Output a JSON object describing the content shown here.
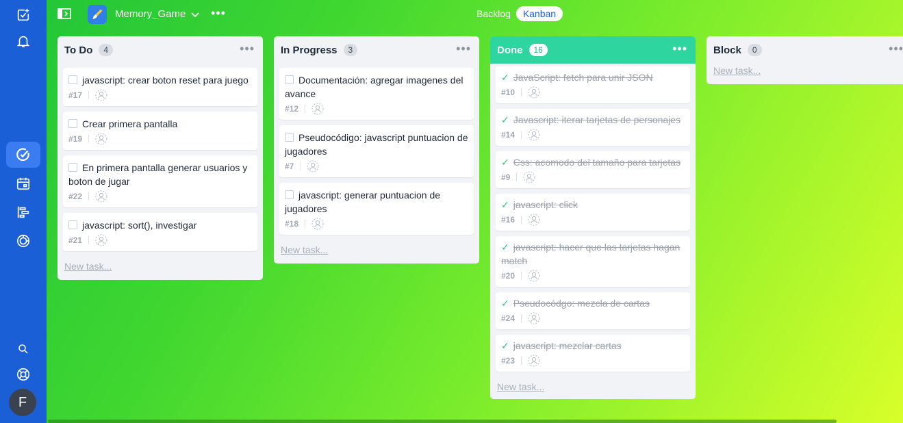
{
  "project": {
    "name": "Memory_Game"
  },
  "views": {
    "backlog": "Backlog",
    "kanban": "Kanban"
  },
  "sidebar": {
    "user_initial": "F",
    "icons": [
      "add-task-icon",
      "bell-icon",
      "check-circle-icon",
      "calendar-icon",
      "gantt-icon",
      "pie-chart-icon",
      "search-icon",
      "lifebuoy-icon"
    ]
  },
  "colors": {
    "sidebar": "#1a5fd6",
    "done_header": "#2ed59e",
    "done_check": "#2ec27e"
  },
  "columns": [
    {
      "title": "To Do",
      "count": "4",
      "new_task": "New task...",
      "cards": [
        {
          "title": "javascript: crear boton reset para juego",
          "id": "#17"
        },
        {
          "title": "Crear primera pantalla",
          "id": "#19"
        },
        {
          "title": "En primera pantalla generar usuarios y boton de jugar",
          "id": "#22"
        },
        {
          "title": "javascript: sort(), investigar",
          "id": "#21"
        }
      ]
    },
    {
      "title": "In Progress",
      "count": "3",
      "new_task": "New task...",
      "cards": [
        {
          "title": "Documentación: agregar imagenes del avance",
          "id": "#12"
        },
        {
          "title": "Pseudocódigo: javascript puntuacion de jugadores",
          "id": "#7"
        },
        {
          "title": "javascript: generar puntuacion de jugadores",
          "id": "#18"
        }
      ]
    },
    {
      "title": "Done",
      "count": "16",
      "new_task": "New task...",
      "cards": [
        {
          "title": "JavaScript: fetch para unir  JSON",
          "id": "#10"
        },
        {
          "title": "Javascript: iterar tarjetas de personajes",
          "id": "#14"
        },
        {
          "title": "Css: acomodo del tamaño para tarjetas",
          "id": "#9"
        },
        {
          "title": "javascript: click",
          "id": "#16"
        },
        {
          "title": "javascript: hacer que las tarjetas hagan match",
          "id": "#20"
        },
        {
          "title": "Pseudocódgo: mezcla de cartas",
          "id": "#24"
        },
        {
          "title": "javascript: mezclar cartas",
          "id": "#23"
        }
      ]
    },
    {
      "title": "Block",
      "count": "0",
      "new_task": "New task...",
      "cards": []
    }
  ]
}
